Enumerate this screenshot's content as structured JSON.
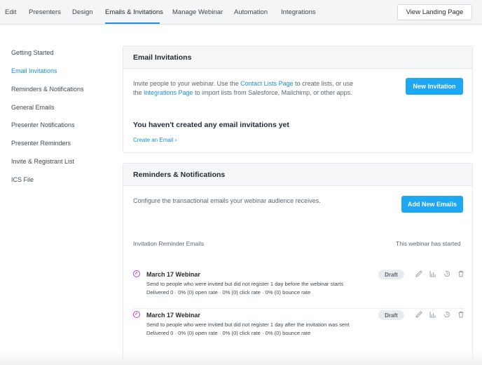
{
  "topnav": {
    "tabs": [
      {
        "label": "Edit"
      },
      {
        "label": "Presenters"
      },
      {
        "label": "Design"
      },
      {
        "label": "Emails & Invitations"
      },
      {
        "label": "Manage Webinar"
      },
      {
        "label": "Automation"
      },
      {
        "label": "Integrations"
      }
    ],
    "active_tab": "Emails & Invitations",
    "landing_button": "View Landing Page"
  },
  "sidebar": {
    "items": [
      {
        "label": "Getting Started"
      },
      {
        "label": "Email Invitations"
      },
      {
        "label": "Reminders & Notifications"
      },
      {
        "label": "General Emails"
      },
      {
        "label": "Presenter Notifications"
      },
      {
        "label": "Presenter Reminders"
      },
      {
        "label": "Invite & Registrant List"
      },
      {
        "label": "ICS File"
      }
    ],
    "active_item": "Email Invitations"
  },
  "email_invitations": {
    "title": "Email Invitations",
    "desc_1": "Invite people to your webinar. Use the ",
    "link_contact": "Contact Lists Page",
    "desc_2": " to create lists, or use the ",
    "link_integrations": "Integrations Page",
    "desc_3": " to import lists from Salesforce, Mailchimp, or other apps.",
    "new_button": "New Invitation",
    "empty_title": "You haven't created any email invitations yet",
    "create_link": "Create an Email ›"
  },
  "reminders": {
    "title": "Reminders & Notifications",
    "desc": "Configure the transactional emails your webinar audience receives.",
    "add_button": "Add New Emails",
    "section_label": "Invitation Reminder Emails",
    "status_note": "This webinar has started",
    "rows": [
      {
        "title": "March 17 Webinar",
        "desc": "Send to people who were invited but did not register 1 day before the webinar starts",
        "stats": "Delivered 0 · 0% (0) open rate · 0% (0) click rate · 0% (0) bounce rate",
        "badge": "Draft"
      },
      {
        "title": "March 17 Webinar",
        "desc": "Send to people who were invited but did not register 1 day after the invitation was sent",
        "stats": "Delivered 0 · 0% (0) open rate · 0% (0) click rate · 0% (0) bounce rate",
        "badge": "Draft"
      }
    ]
  },
  "icons": {
    "row_status": "clock-icon",
    "row_actions": [
      "edit-icon",
      "stats-icon",
      "history-icon",
      "trash-icon"
    ]
  },
  "colors": {
    "accent": "#1a8fe0",
    "button": "#1ea7f3",
    "status_icon": "#c43ec9"
  }
}
